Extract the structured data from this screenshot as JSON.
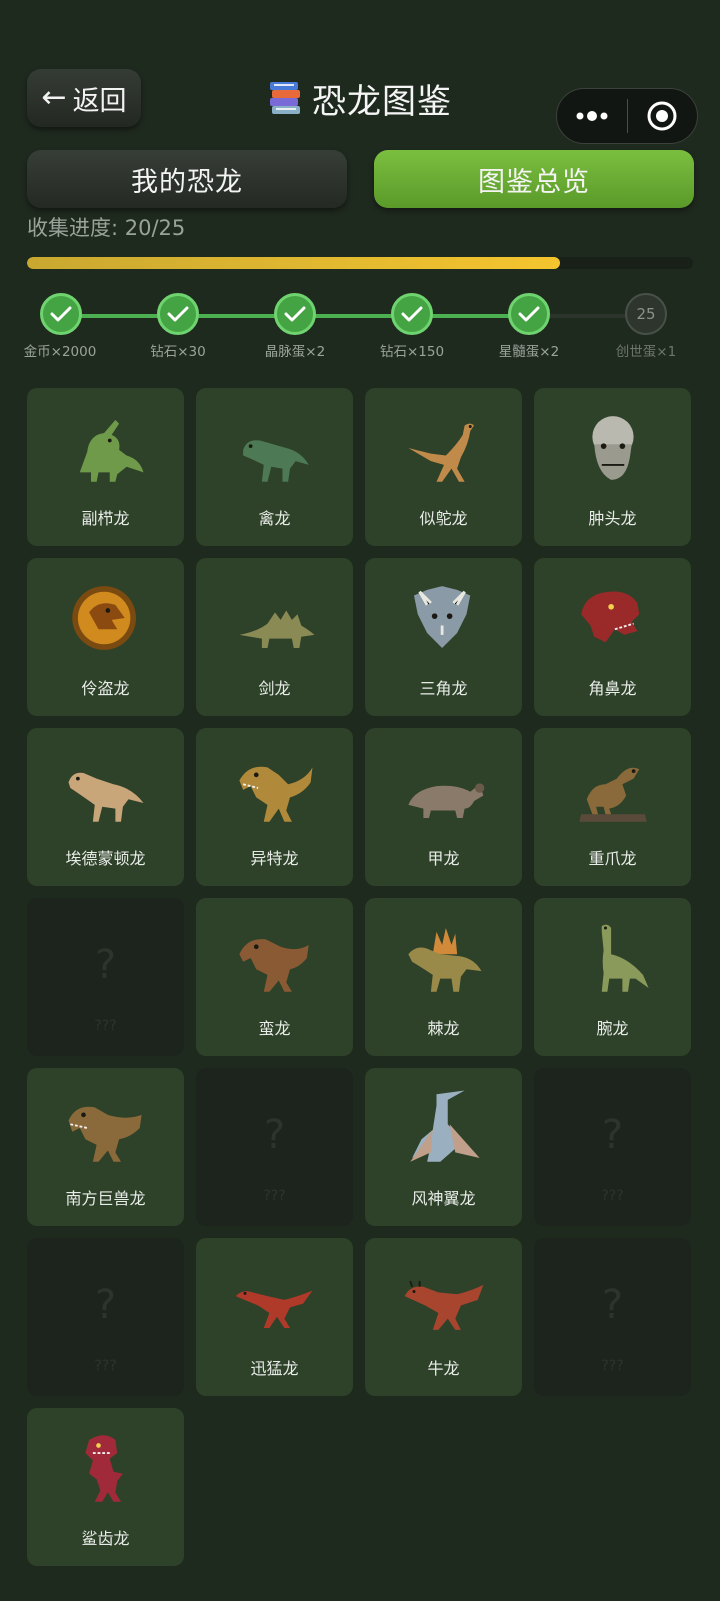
{
  "header": {
    "back_label": "返回",
    "title": "恐龙图鉴"
  },
  "tabs": {
    "mine": "我的恐龙",
    "overview": "图鉴总览",
    "active": "overview"
  },
  "progress": {
    "label": "收集进度: 20/25",
    "collected": 20,
    "total": 25,
    "fill_fraction": 0.8
  },
  "milestones": [
    {
      "reward": "金币×2000",
      "done": true,
      "number": ""
    },
    {
      "reward": "钻石×30",
      "done": true,
      "number": ""
    },
    {
      "reward": "晶脉蛋×2",
      "done": true,
      "number": ""
    },
    {
      "reward": "钻石×150",
      "done": true,
      "number": ""
    },
    {
      "reward": "星髓蛋×2",
      "done": true,
      "number": ""
    },
    {
      "reward": "创世蛋×1",
      "done": false,
      "number": "25"
    }
  ],
  "colors": {
    "background": "#1f2a1f",
    "card": "#2e4129",
    "card_locked": "#1d241d",
    "accent_green": "#6aad35",
    "progress_gold": "#f5c52f",
    "milestone_done": "#44a444"
  },
  "dinos": [
    {
      "name": "副栉龙",
      "unlocked": true,
      "icon": "parasaurolophus-icon",
      "color": "#6f9a4a"
    },
    {
      "name": "禽龙",
      "unlocked": true,
      "icon": "iguanodon-icon",
      "color": "#4d7a55"
    },
    {
      "name": "似鸵龙",
      "unlocked": true,
      "icon": "struthiomimus-icon",
      "color": "#c08a4a"
    },
    {
      "name": "肿头龙",
      "unlocked": true,
      "icon": "pachycephalosaurus-icon",
      "color": "#b9b9b0"
    },
    {
      "name": "伶盗龙",
      "unlocked": true,
      "icon": "velociraptor-icon",
      "color": "#d08a1e"
    },
    {
      "name": "剑龙",
      "unlocked": true,
      "icon": "stegosaurus-icon",
      "color": "#8a8a55"
    },
    {
      "name": "三角龙",
      "unlocked": true,
      "icon": "triceratops-icon",
      "color": "#8a9aa6"
    },
    {
      "name": "角鼻龙",
      "unlocked": true,
      "icon": "ceratosaurus-icon",
      "color": "#9a2a2a"
    },
    {
      "name": "埃德蒙顿龙",
      "unlocked": true,
      "icon": "edmontosaurus-icon",
      "color": "#c9a57a"
    },
    {
      "name": "异特龙",
      "unlocked": true,
      "icon": "allosaurus-icon",
      "color": "#b08a3a"
    },
    {
      "name": "甲龙",
      "unlocked": true,
      "icon": "ankylosaurus-icon",
      "color": "#8a7a6a"
    },
    {
      "name": "重爪龙",
      "unlocked": true,
      "icon": "baryonyx-icon",
      "color": "#8a6a3a"
    },
    {
      "name": "???",
      "unlocked": false,
      "icon": "locked-icon",
      "color": "#2c342c"
    },
    {
      "name": "蛮龙",
      "unlocked": true,
      "icon": "torvosaurus-icon",
      "color": "#8a5a35"
    },
    {
      "name": "棘龙",
      "unlocked": true,
      "icon": "spinosaurus-icon",
      "color": "#9a8a4a"
    },
    {
      "name": "腕龙",
      "unlocked": true,
      "icon": "brachiosaurus-icon",
      "color": "#8a9a5a"
    },
    {
      "name": "南方巨兽龙",
      "unlocked": true,
      "icon": "giganotosaurus-icon",
      "color": "#8a6a3a"
    },
    {
      "name": "???",
      "unlocked": false,
      "icon": "locked-icon",
      "color": "#2c342c"
    },
    {
      "name": "风神翼龙",
      "unlocked": true,
      "icon": "quetzalcoatlus-icon",
      "color": "#9ab0c0"
    },
    {
      "name": "???",
      "unlocked": false,
      "icon": "locked-icon",
      "color": "#2c342c"
    },
    {
      "name": "???",
      "unlocked": false,
      "icon": "locked-icon",
      "color": "#2c342c"
    },
    {
      "name": "迅猛龙",
      "unlocked": true,
      "icon": "raptor-icon",
      "color": "#b03a2a"
    },
    {
      "name": "牛龙",
      "unlocked": true,
      "icon": "carnotaurus-icon",
      "color": "#a8452e"
    },
    {
      "name": "???",
      "unlocked": false,
      "icon": "locked-icon",
      "color": "#2c342c"
    },
    {
      "name": "鲨齿龙",
      "unlocked": true,
      "icon": "carcharodontosaurus-icon",
      "color": "#a02a3a"
    }
  ],
  "locked_symbol": "?"
}
